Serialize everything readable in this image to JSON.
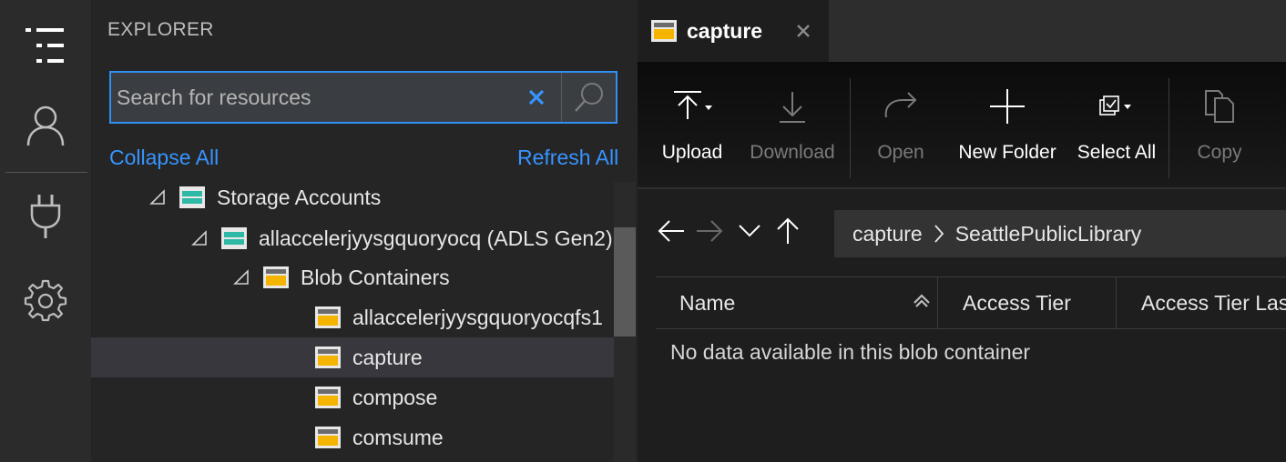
{
  "explorer": {
    "title": "EXPLORER",
    "search_placeholder": "Search for resources",
    "collapse_all": "Collapse All",
    "refresh_all": "Refresh All",
    "tree": {
      "storage_accounts": "Storage Accounts",
      "account": "allaccelerjyysgquoryocq (ADLS Gen2)",
      "blob_containers": "Blob Containers",
      "containers": [
        "allaccelerjyysgquoryocqfs1",
        "capture",
        "compose",
        "comsume"
      ]
    }
  },
  "editor": {
    "tab_title": "capture",
    "toolbar": {
      "upload": "Upload",
      "download": "Download",
      "open": "Open",
      "new_folder": "New Folder",
      "select_all": "Select All",
      "copy": "Copy"
    },
    "breadcrumb": [
      "capture",
      "SeattlePublicLibrary"
    ],
    "columns": [
      "Name",
      "Access Tier",
      "Access Tier Last Modified"
    ],
    "empty_message": "No data available in this blob container"
  },
  "colors": {
    "accent": "#2f8ff2",
    "link": "#3794ff",
    "selected_row": "#37373d"
  }
}
